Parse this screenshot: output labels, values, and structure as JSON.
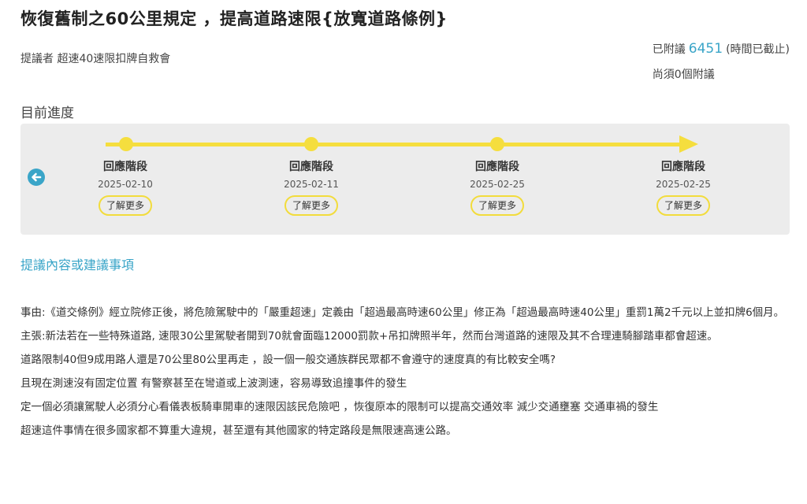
{
  "petition": {
    "title": "恢復舊制之60公里規定 ，提高道路速限{放寬道路條例}",
    "proposer_label": "提議者",
    "proposer_name": "超速40速限扣牌自救會"
  },
  "stats": {
    "attached_label": "已附議",
    "attached_count": "6451",
    "status": "(時間已截止)",
    "remaining": "尚須0個附議"
  },
  "progress": {
    "title": "目前進度",
    "stages": [
      {
        "label": "回應階段",
        "date": "2025-02-10",
        "more": "了解更多"
      },
      {
        "label": "回應階段",
        "date": "2025-02-11",
        "more": "了解更多"
      },
      {
        "label": "回應階段",
        "date": "2025-02-25",
        "more": "了解更多"
      },
      {
        "label": "回應階段",
        "date": "2025-02-25",
        "more": "了解更多"
      }
    ],
    "track_color": "#f5de3e"
  },
  "section": {
    "link": "提議內容或建議事項"
  },
  "content": {
    "paragraphs": [
      "事由:《道交條例》經立院修正後，將危險駕駛中的「嚴重超速」定義由「超過最高時速60公里」修正為「超過最高時速40公里」重罰1萬2千元以上並扣牌6個月。",
      "主張:新法若在一些特殊道路, 速限30公里駕駛者開到70就會面臨12000罰款+吊扣牌照半年，然而台灣道路的速限及其不合理連騎腳踏車都會超速。",
      "道路限制40但9成用路人還是70公里80公里再走 ，設一個一般交通族群民眾都不會遵守的速度真的有比較安全嗎?",
      "且現在測速沒有固定位置 有警察甚至在彎道或上波測速，容易導致追撞事件的發生",
      "定一個必須讓駕駛人必須分心看儀表板騎車開車的速限因該民危險吧 ，恢復原本的限制可以提高交通效率 減少交通壅塞 交通車禍的發生",
      "超速這件事情在很多國家都不算重大違規，甚至還有其他國家的特定路段是無限速高速公路。"
    ]
  },
  "icons": {
    "back": "arrow-left-circle-icon"
  },
  "colors": {
    "accent": "#3aa5c8",
    "timeline_bg": "#ececec",
    "yellow": "#f5de3e"
  }
}
